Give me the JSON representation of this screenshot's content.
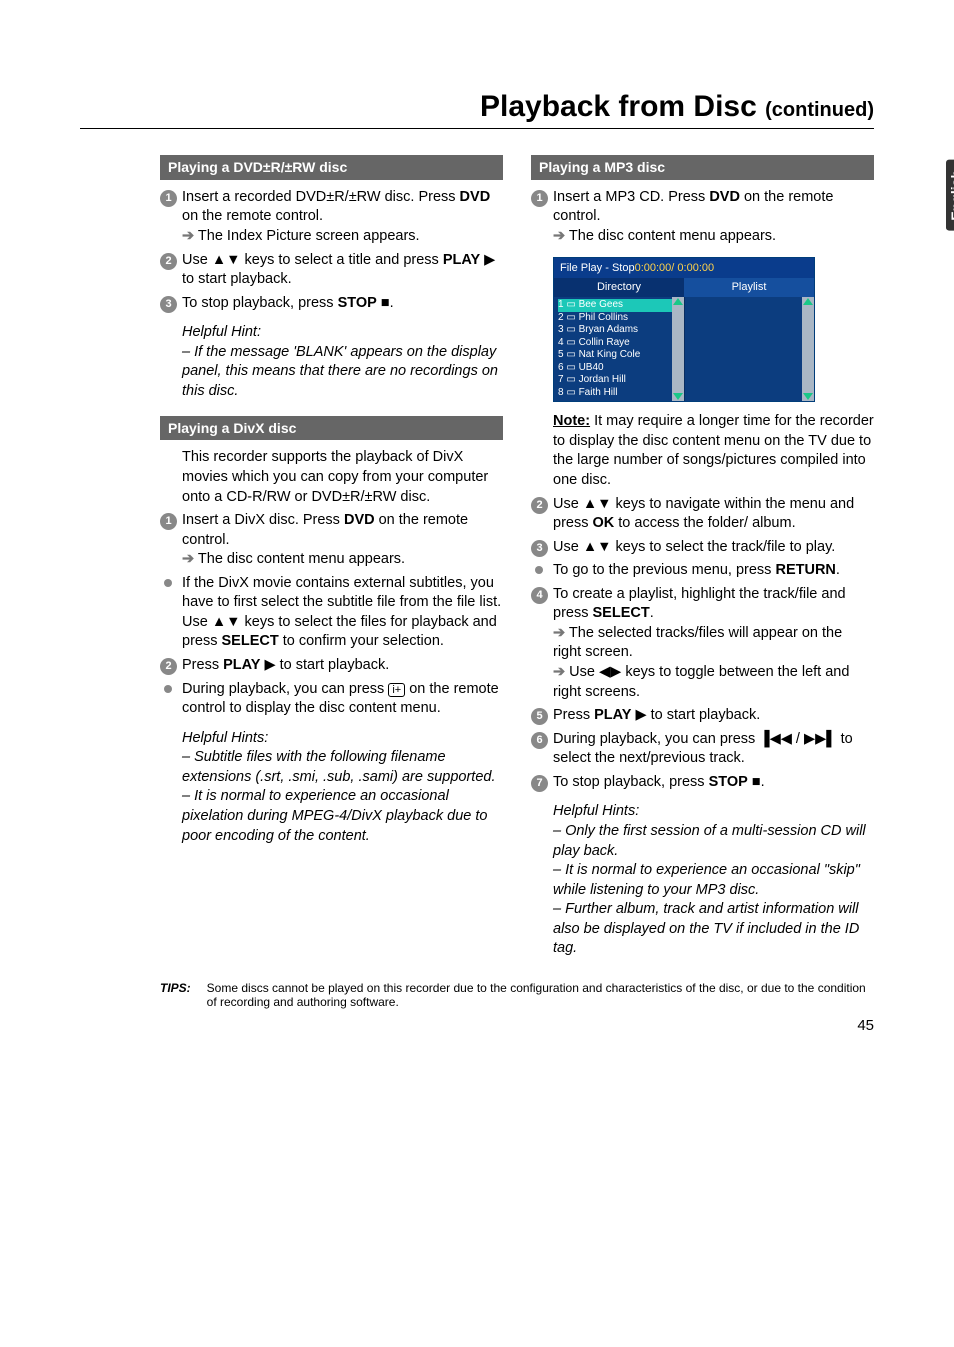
{
  "page": {
    "title_main": "Playback from Disc ",
    "title_cont": "(continued)",
    "lang_tab": "English",
    "page_number": "45"
  },
  "tips": {
    "label": "TIPS:",
    "text": "Some discs cannot be played on this recorder due to the configuration and characteristics of the disc, or due to the condition of recording and authoring software."
  },
  "left": {
    "sec1_head": "Playing a DVD±R/±RW disc",
    "s1a": "Insert a recorded DVD±R/±RW disc. Press ",
    "s1b": "DVD",
    "s1c": " on the remote control.",
    "s1_res": " The Index Picture screen appears.",
    "s2a": "Use ▲▼ keys to select a title and press ",
    "s2b": "PLAY",
    "s2c": " ▶ to start playback.",
    "s3a": "To stop playback, press ",
    "s3b": "STOP",
    "s3c": " ■.",
    "hint1_title": "Helpful Hint:",
    "hint1_text": "– If the message 'BLANK' appears on the display panel, this means that there are no recordings on this disc.",
    "sec2_head": "Playing a DivX disc",
    "divx_intro": "This recorder supports the playback of DivX movies which you can copy from your computer onto a CD-R/RW or DVD±R/±RW disc.",
    "d1a": "Insert a DivX disc. Press ",
    "d1b": "DVD",
    "d1c": " on the remote control.",
    "d1_res": " The disc content menu appears.",
    "dba": "If the DivX movie contains external subtitles, you have to first select the subtitle file from the file list.",
    "dbb": "Use ▲▼ keys to select the files for playback and press ",
    "dbc": "SELECT",
    "dbd": " to confirm your selection.",
    "d2a": "Press ",
    "d2b": "PLAY",
    "d2c": " ▶ to start playback.",
    "d_play_a": "During playback, you can press ",
    "d_play_icon": "i+",
    "d_play_b": " on the remote control to display the disc content menu.",
    "hint2_title": "Helpful Hints:",
    "hint2_a": "– Subtitle files with the following filename extensions (.srt, .smi, .sub, .sami) are supported.",
    "hint2_b": "– It is normal to experience an occasional pixelation during MPEG-4/DivX playback due to poor encoding of the content."
  },
  "right": {
    "sec_head": "Playing a MP3 disc",
    "m1a": "Insert a MP3 CD. Press ",
    "m1b": "DVD",
    "m1c": " on the remote control.",
    "m1_res": " The disc content menu appears.",
    "fileplay": {
      "title_a": "File Play - Stop",
      "title_b": "0:00:00/ 0:00:00",
      "tab1": "Directory",
      "tab2": "Playlist",
      "items": [
        "1 ▭ Bee Gees",
        "2 ▭ Phil Collins",
        "3 ▭ Bryan Adams",
        "4 ▭ Collin Raye",
        "5 ▭ Nat King Cole",
        "6 ▭ UB40",
        "7 ▭ Jordan Hill",
        "8 ▭ Faith Hill"
      ]
    },
    "note_label": "Note:",
    "note_text": " It may require a longer time for the recorder to display the disc content menu on the TV due to the large number of songs/pictures compiled into one disc.",
    "m2a": "Use ▲▼ keys to navigate within the menu and press ",
    "m2b": "OK",
    "m2c": " to access the folder/ album.",
    "m3a": "Use ▲▼ keys to select the track/file to play.",
    "mret_a": "To go to the previous menu, press ",
    "mret_b": "RETURN",
    "mret_c": ".",
    "m4a": "To create a playlist, highlight the track/file and press ",
    "m4b": "SELECT",
    "m4c": ".",
    "m4_res1": " The selected tracks/files will appear on the right screen.",
    "m4_res2": " Use ◀▶ keys to toggle between the left and right screens.",
    "m5a": "Press ",
    "m5b": "PLAY",
    "m5c": " ▶ to start playback.",
    "m6a": "During playback, you can press ▐◀◀ / ▶▶▌ to select the next/previous track.",
    "m7a": "To stop playback, press ",
    "m7b": "STOP",
    "m7c": " ■.",
    "hint_title": "Helpful Hints:",
    "hint_a": "–  Only the first session of a multi-session CD will play back.",
    "hint_b": "–  It is normal to experience an occasional \"skip\" while listening to your MP3 disc.",
    "hint_c": "–  Further album, track and artist information will also be displayed on the TV if included in the ID tag."
  }
}
